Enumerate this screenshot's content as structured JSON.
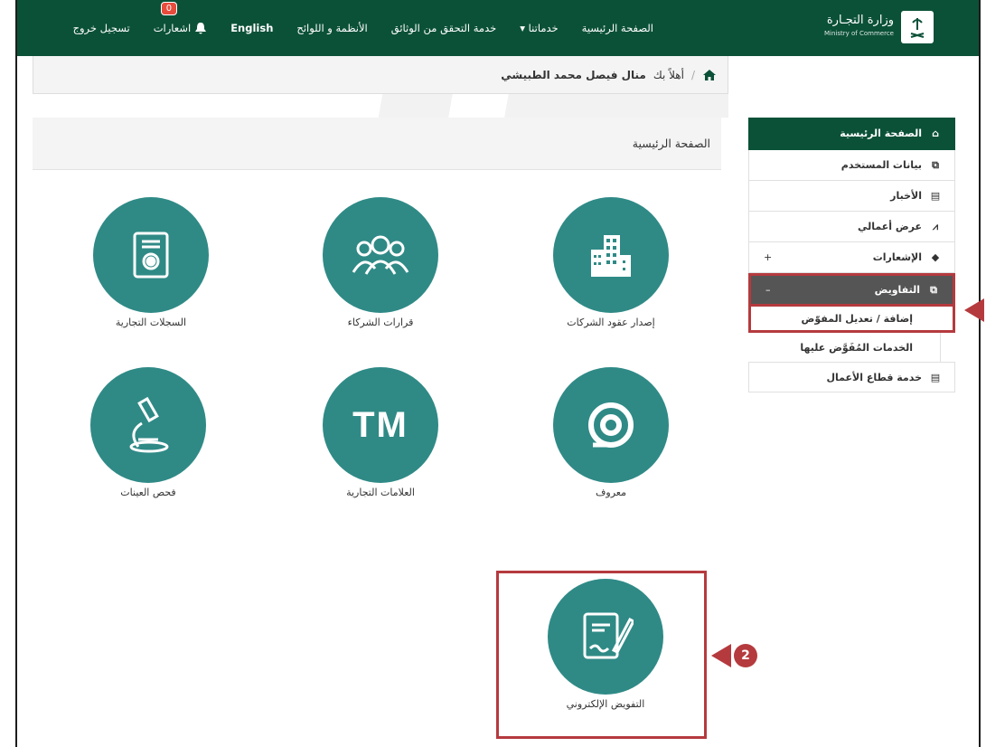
{
  "header": {
    "logo_ar": "وزارة التجـارة",
    "logo_en": "Ministry of Commerce",
    "nav": {
      "home": "الصفحة الرئيسية",
      "services": "خدماتنا ▾",
      "verify": "خدمة التحقق من الوثائق",
      "regulations": "الأنظمة و اللوائح",
      "english": "English",
      "notifications": "اشعارات",
      "notifications_count": "0",
      "logout": "تسجيل خروج"
    }
  },
  "breadcrumb": {
    "welcome": "أهلاً بك",
    "user": "منال فيصل محمد الطبيشي"
  },
  "main": {
    "title": "الصفحة الرئيسية",
    "tiles": [
      {
        "label": "إصدار عقود الشركات",
        "icon": "building-icon"
      },
      {
        "label": "قرارات الشركاء",
        "icon": "people-icon"
      },
      {
        "label": "السجلات التجارية",
        "icon": "certificate-icon"
      },
      {
        "label": "معروف",
        "icon": "maroof-icon"
      },
      {
        "label": "العلامات التجارية",
        "icon": "tm-icon",
        "text": "TM"
      },
      {
        "label": "فحص العينات",
        "icon": "microscope-icon"
      },
      {
        "label": "التفويض الإلكتروني",
        "icon": "e-signature-icon"
      }
    ]
  },
  "sidebar": {
    "items": [
      {
        "label": "الصفحة الرئيسية"
      },
      {
        "label": "بيانات المستخدم"
      },
      {
        "label": "الأخبار"
      },
      {
        "label": "عرض أعمالي"
      },
      {
        "label": "الإشعارات",
        "toggle": "+"
      },
      {
        "label": "التفاويض",
        "toggle": "–"
      },
      {
        "label": "خدمة قطاع الأعمال"
      }
    ],
    "sub": [
      {
        "label": "إضافة / تعديل المفوّض"
      },
      {
        "label": "الخدمات المُفَوَّض عليها"
      }
    ]
  },
  "annotations": {
    "marker2": "2"
  },
  "colors": {
    "brand": "#0b5138",
    "tile": "#2f8a86",
    "highlight": "#b53a3e"
  }
}
